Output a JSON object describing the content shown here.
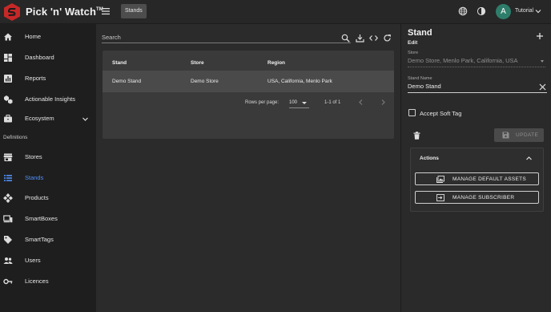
{
  "app": {
    "brand": "Pick 'n' Watch",
    "brand_mark": "TM",
    "breadcrumb": "Stands",
    "user_initial": "A",
    "user_name": "Tutorial"
  },
  "sidebar": {
    "items": [
      {
        "label": "Home",
        "icon": "home-icon"
      },
      {
        "label": "Dashboard",
        "icon": "dashboard-icon"
      },
      {
        "label": "Reports",
        "icon": "reports-icon"
      },
      {
        "label": "Actionable Insights",
        "icon": "insights-icon"
      },
      {
        "label": "Ecosystem",
        "icon": "briefcase-icon"
      }
    ],
    "section_label": "Definitions",
    "definitions": [
      {
        "label": "Stores",
        "icon": "store-icon"
      },
      {
        "label": "Stands",
        "icon": "list-icon",
        "active": true
      },
      {
        "label": "Products",
        "icon": "products-icon"
      },
      {
        "label": "SmartBoxes",
        "icon": "devices-icon"
      },
      {
        "label": "SmartTags",
        "icon": "tag-icon"
      },
      {
        "label": "Users",
        "icon": "users-icon"
      },
      {
        "label": "Licences",
        "icon": "key-icon"
      }
    ],
    "active_color": "#4f8ff7"
  },
  "main": {
    "search_placeholder": "Search",
    "table": {
      "columns": [
        "Stand",
        "Store",
        "Region"
      ],
      "rows": [
        [
          "Demo Stand",
          "Demo Store",
          "USA, California, Menlo Park"
        ]
      ]
    },
    "pagination": {
      "rows_per_page_label": "Rows per page:",
      "rows_per_page": "100",
      "range": "1-1 of 1"
    }
  },
  "panel": {
    "title": "Stand",
    "subtitle": "Edit",
    "store_label": "Store",
    "store_value": "Demo Store, Menlo Park, California, USA",
    "name_label": "Stand Name",
    "name_value": "Demo Stand",
    "accept_soft_tag_label": "Accept Soft Tag",
    "accept_soft_tag_checked": false,
    "update_label": "UPDATE",
    "actions_title": "Actions",
    "manage_assets_label": "MANAGE DEFAULT ASSETS",
    "manage_subscriber_label": "MANAGE SUBSCRIBER"
  }
}
